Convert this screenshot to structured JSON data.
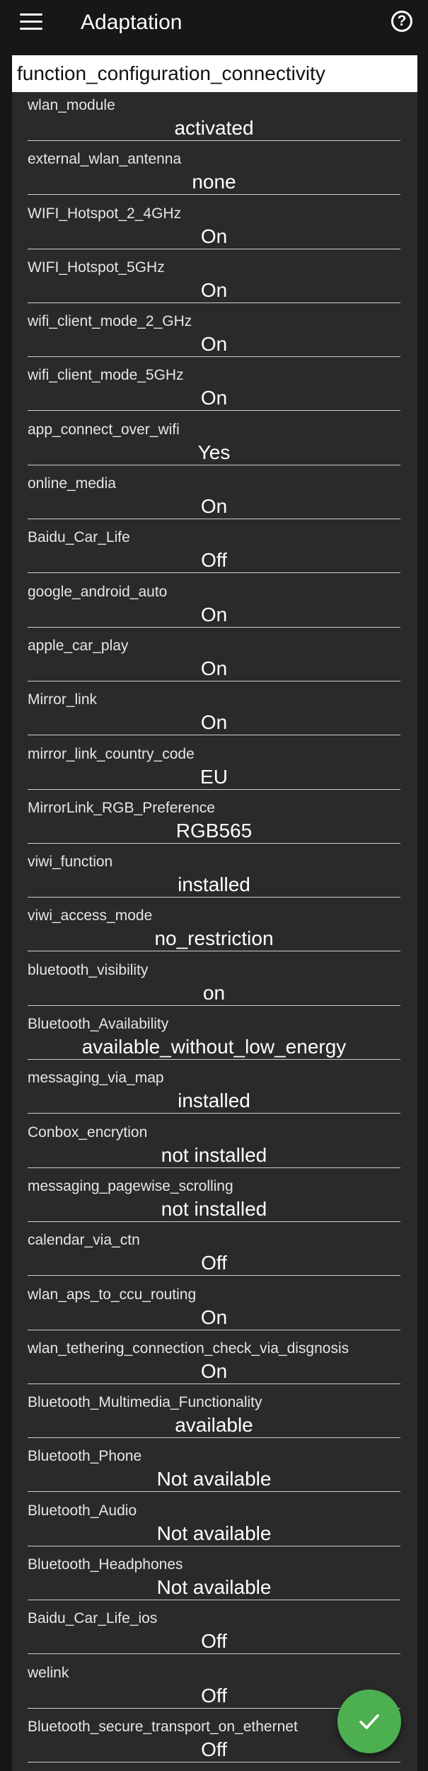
{
  "header": {
    "title": "Adaptation"
  },
  "section": {
    "title": "function_configuration_connectivity"
  },
  "rows": [
    {
      "label": "wlan_module",
      "value": "activated"
    },
    {
      "label": "external_wlan_antenna",
      "value": "none"
    },
    {
      "label": "WIFI_Hotspot_2_4GHz",
      "value": "On"
    },
    {
      "label": "WIFI_Hotspot_5GHz",
      "value": "On"
    },
    {
      "label": "wifi_client_mode_2_GHz",
      "value": "On"
    },
    {
      "label": "wifi_client_mode_5GHz",
      "value": "On"
    },
    {
      "label": "app_connect_over_wifi",
      "value": "Yes"
    },
    {
      "label": "online_media",
      "value": "On"
    },
    {
      "label": "Baidu_Car_Life",
      "value": "Off"
    },
    {
      "label": "google_android_auto",
      "value": "On"
    },
    {
      "label": "apple_car_play",
      "value": "On"
    },
    {
      "label": "Mirror_link",
      "value": "On"
    },
    {
      "label": "mirror_link_country_code",
      "value": "EU"
    },
    {
      "label": "MirrorLink_RGB_Preference",
      "value": "RGB565"
    },
    {
      "label": "viwi_function",
      "value": "installed"
    },
    {
      "label": "viwi_access_mode",
      "value": "no_restriction"
    },
    {
      "label": "bluetooth_visibility",
      "value": "on"
    },
    {
      "label": "Bluetooth_Availability",
      "value": "available_without_low_energy"
    },
    {
      "label": "messaging_via_map",
      "value": "installed"
    },
    {
      "label": "Conbox_encrytion",
      "value": "not installed"
    },
    {
      "label": "messaging_pagewise_scrolling",
      "value": "not installed"
    },
    {
      "label": "calendar_via_ctn",
      "value": "Off"
    },
    {
      "label": "wlan_aps_to_ccu_routing",
      "value": "On"
    },
    {
      "label": "wlan_tethering_connection_check_via_disgnosis",
      "value": "On"
    },
    {
      "label": "Bluetooth_Multimedia_Functionality",
      "value": "available"
    },
    {
      "label": "Bluetooth_Phone",
      "value": "Not available"
    },
    {
      "label": "Bluetooth_Audio",
      "value": "Not available"
    },
    {
      "label": "Bluetooth_Headphones",
      "value": "Not available"
    },
    {
      "label": "Baidu_Car_Life_ios",
      "value": "Off"
    },
    {
      "label": "welink",
      "value": "Off"
    },
    {
      "label": "Bluetooth_secure_transport_on_ethernet",
      "value": "Off"
    }
  ],
  "colors": {
    "background": "#171717",
    "list_background": "#2a2a2a",
    "fab": "#4caf50"
  },
  "icons": {
    "menu": "hamburger-icon",
    "help": "help-circle-icon",
    "confirm": "checkmark-icon"
  }
}
